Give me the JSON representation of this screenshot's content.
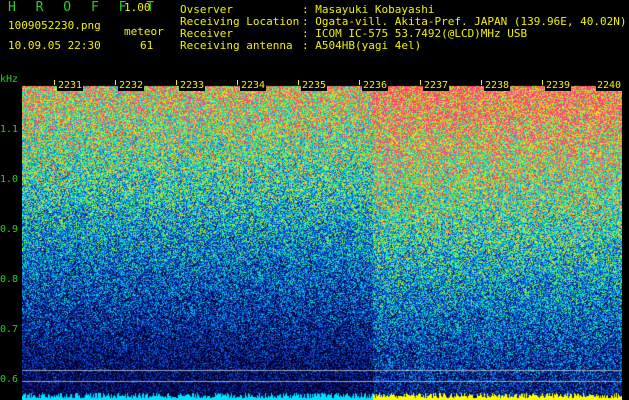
{
  "app": {
    "name": "H R O F F T",
    "version": "1.00"
  },
  "file": {
    "name": "1009052230.png",
    "datetime": "10.09.05 22:30"
  },
  "meteor": {
    "label": "meteor",
    "count": "61"
  },
  "info": [
    {
      "label": "Ovserver",
      "value": ": Masayuki Kobayashi"
    },
    {
      "label": "Receiving Location",
      "value": ": Ogata-vill. Akita-Pref. JAPAN (139.96E, 40.02N)"
    },
    {
      "label": "Receiver",
      "value": ": ICOM IC-575 53.7492(@LCD)MHz USB"
    },
    {
      "label": "Receiving antenna",
      "value": ": A504HB(yagi 4el)"
    }
  ],
  "yaxis": {
    "unit": "kHz",
    "ticks": [
      "1.1",
      "1.0",
      "0.9",
      "0.8",
      "0.7",
      "0.6"
    ]
  },
  "xaxis": {
    "ticks": [
      "2231",
      "2232",
      "2233",
      "2234",
      "2235",
      "2236",
      "2237",
      "2238",
      "2239",
      "2240"
    ]
  }
}
